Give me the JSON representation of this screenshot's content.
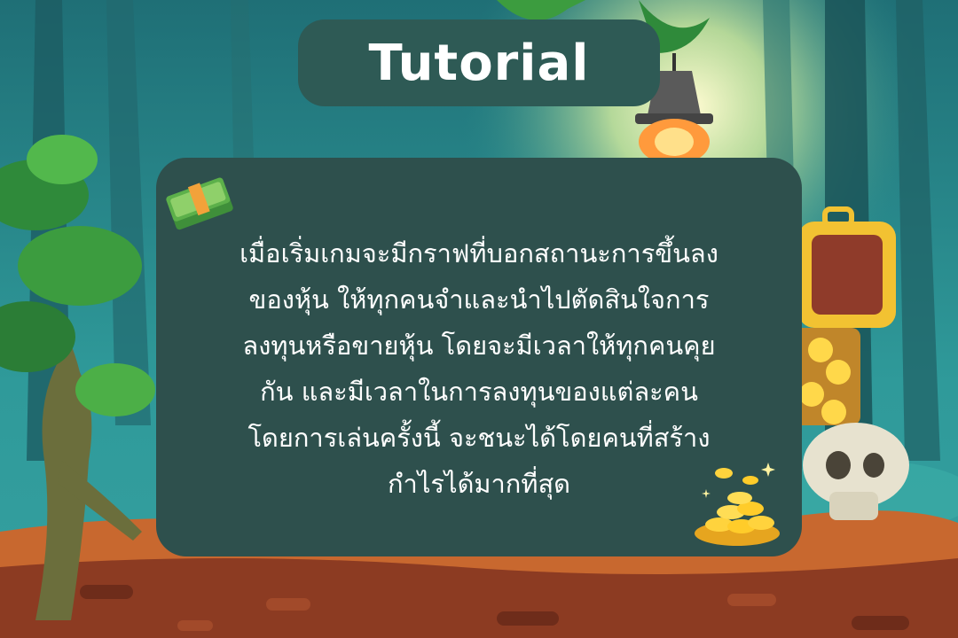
{
  "title": "Tutorial",
  "body_lines": [
    "เมื่อเริ่มเกมจะมีกราฟที่บอกสถานะการขึ้นลง",
    "ของหุ้น ให้ทุกคนจำและนำไปตัดสินใจการ",
    "ลงทุนหรือขายหุ้น โดยจะมีเวลาให้ทุกคนคุย",
    "กัน และมีเวลาในการลงทุนของแต่ละคน",
    "โดยการเล่นครั้งนี้ จะชนะได้โดยคนที่สร้าง",
    "กำไรได้มากที่สุด"
  ],
  "colors": {
    "panel": "#2e504d",
    "title_panel": "#2e5a55",
    "text": "#ffffff",
    "sky": "#2a8c8a",
    "ground": "#b4562e"
  },
  "icons": [
    "money-stack-icon",
    "gold-coins-icon",
    "lantern-icon",
    "treasure-chest-icon",
    "skull-icon",
    "tree-icon"
  ]
}
